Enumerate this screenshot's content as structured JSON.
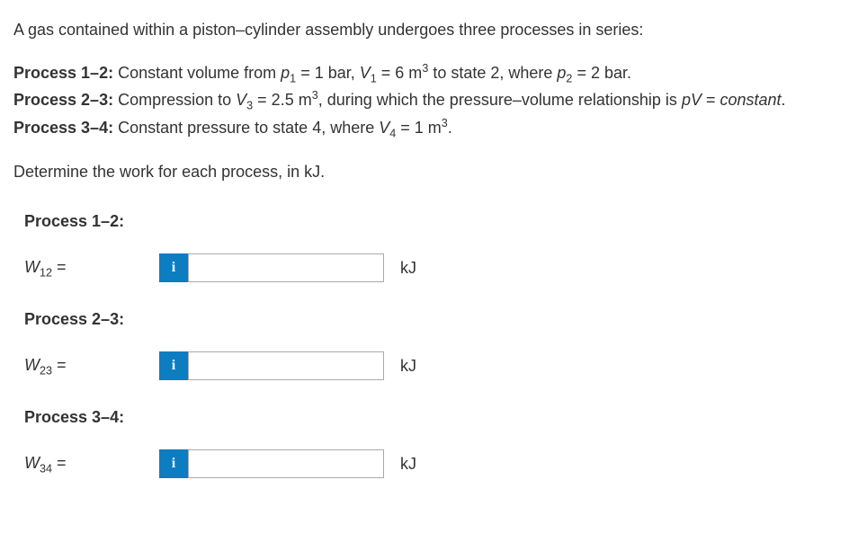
{
  "intro": "A gas contained within a piston–cylinder assembly undergoes three processes in series:",
  "p12_label": "Process 1–2:",
  "p12_text1": " Constant volume from ",
  "p12_var1": "p",
  "p12_sub1": "1",
  "p12_text2": " = 1 bar, ",
  "p12_var2": "V",
  "p12_sub2": "1",
  "p12_text3": " = 6 m",
  "p12_sup3": "3",
  "p12_text4": " to state 2, where ",
  "p12_var3": "p",
  "p12_sub3": "2",
  "p12_text5": " = 2 bar.",
  "p23_label": "Process 2–3:",
  "p23_text1": " Compression to ",
  "p23_var1": "V",
  "p23_sub1": "3",
  "p23_text2": " = 2.5 m",
  "p23_sup2": "3",
  "p23_text3": ", during which the pressure–volume relationship is ",
  "p23_var2": "pV",
  "p23_text4": " = ",
  "p23_italic": "constant",
  "p23_text5": ".",
  "p34_label": "Process 3–4:",
  "p34_text1": " Constant pressure to state 4, where ",
  "p34_var1": "V",
  "p34_sub1": "4",
  "p34_text2": " = 1 m",
  "p34_sup2": "3",
  "p34_text3": ".",
  "determine": "Determine the work for each process, in kJ.",
  "sections": {
    "s1": {
      "heading": "Process 1–2:",
      "var": "W",
      "sub": "12",
      "eq": " =",
      "unit": "kJ"
    },
    "s2": {
      "heading": "Process 2–3:",
      "var": "W",
      "sub": "23",
      "eq": " =",
      "unit": "kJ"
    },
    "s3": {
      "heading": "Process 3–4:",
      "var": "W",
      "sub": "34",
      "eq": " =",
      "unit": "kJ"
    }
  },
  "info_icon": "i"
}
